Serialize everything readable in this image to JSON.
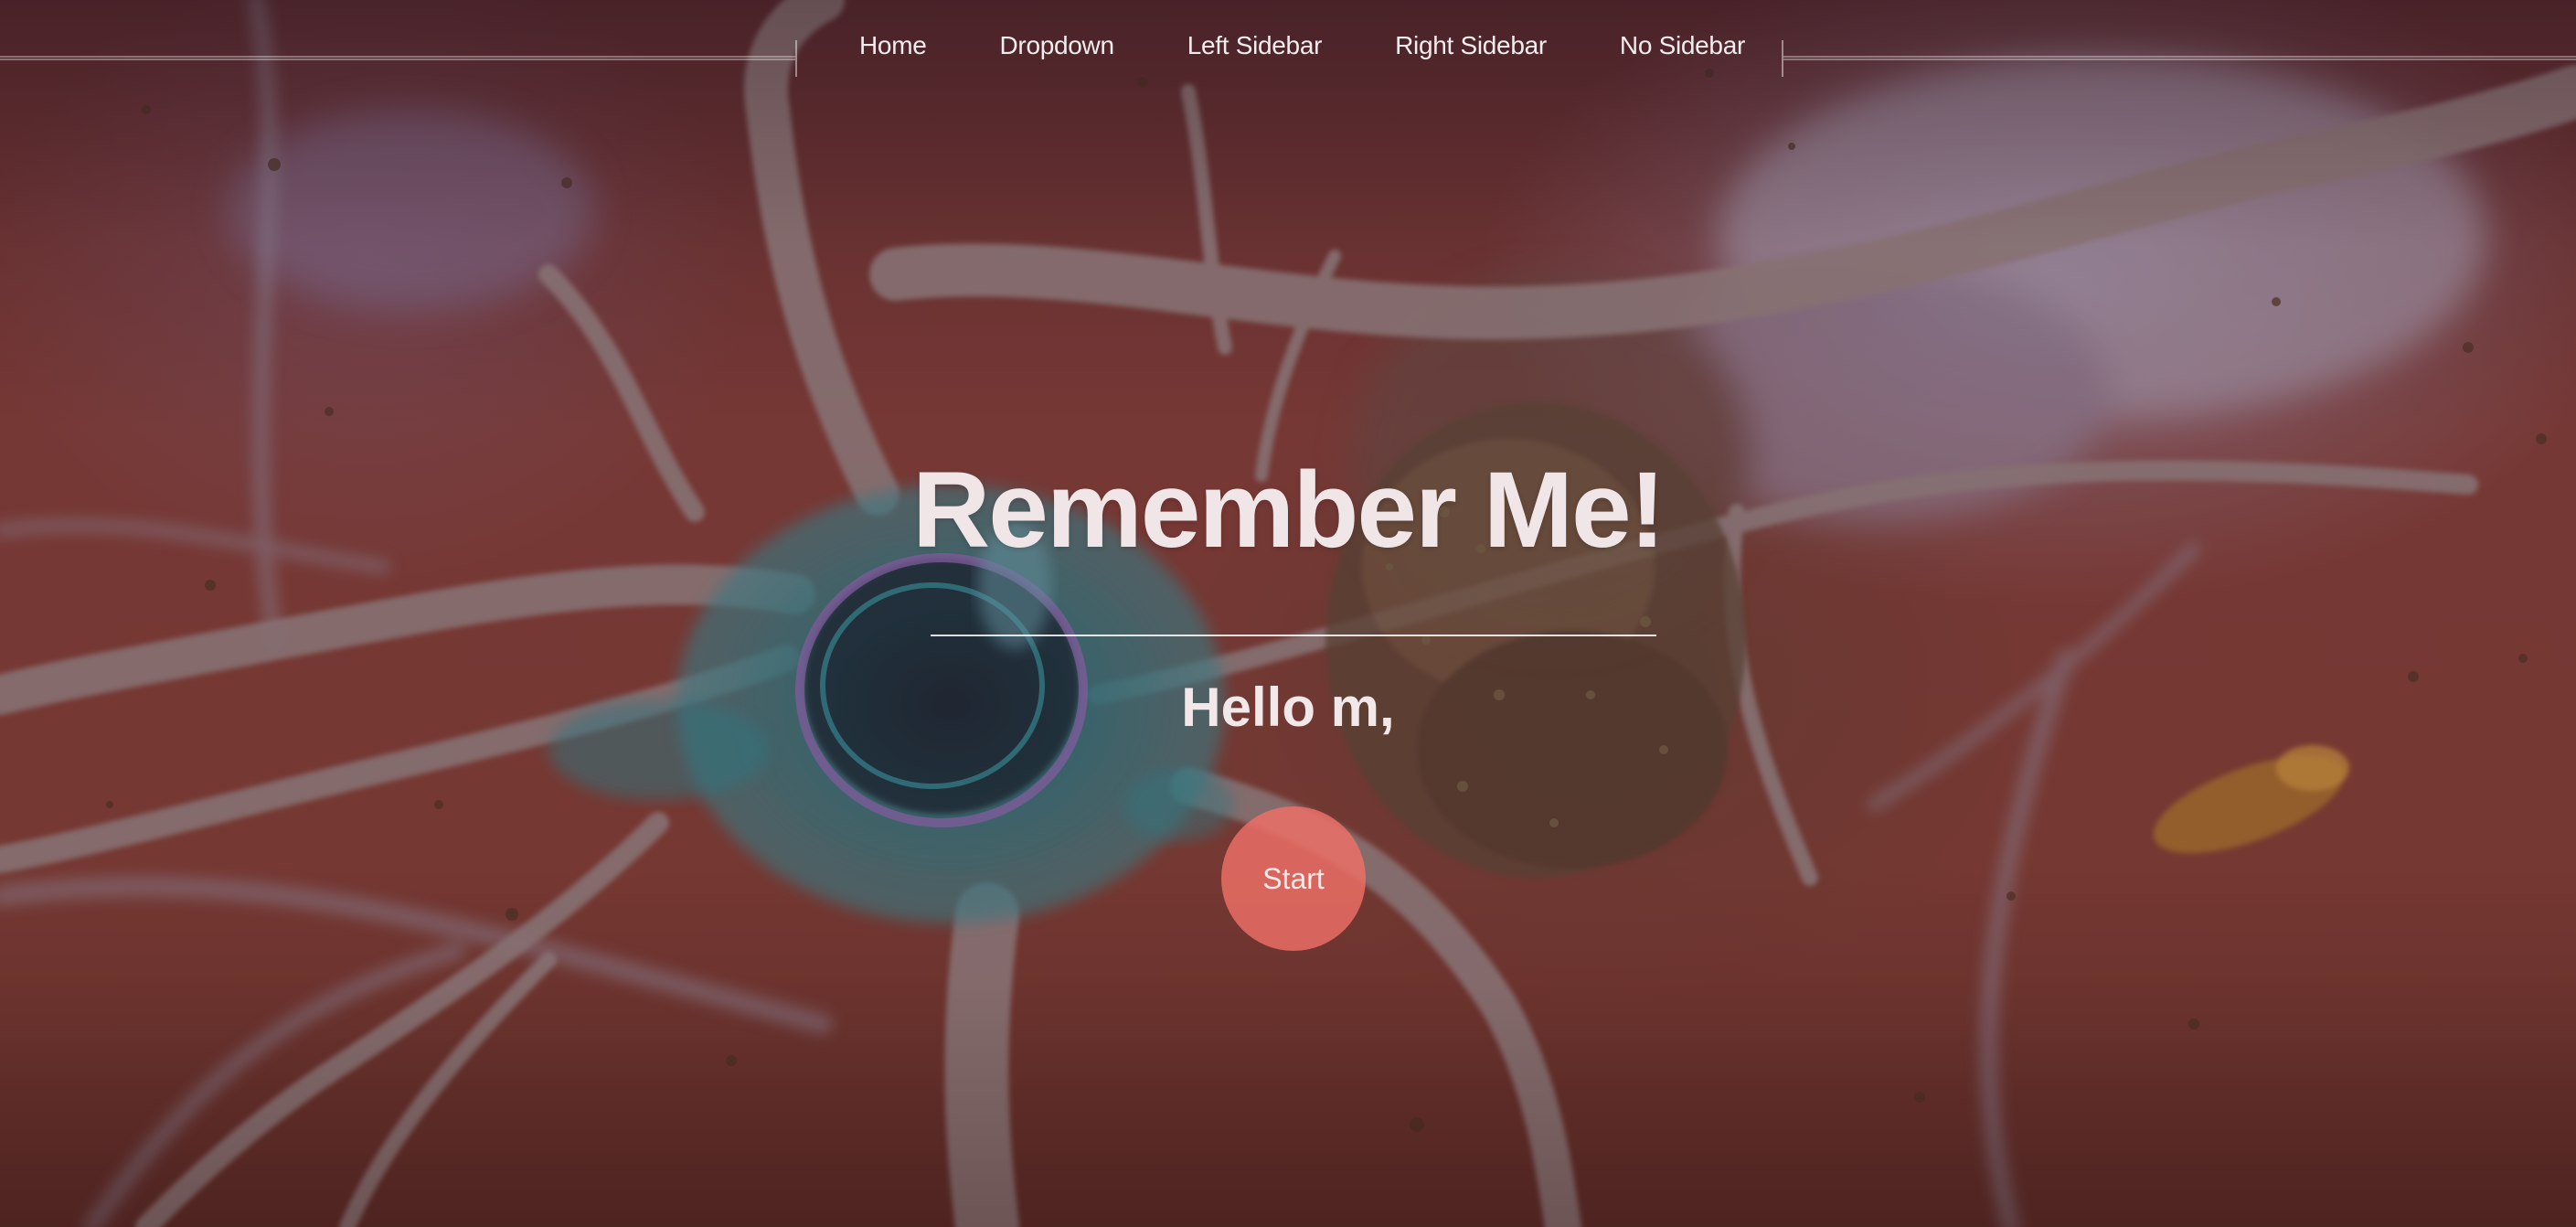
{
  "nav": {
    "items": [
      {
        "label": "Home"
      },
      {
        "label": "Dropdown"
      },
      {
        "label": "Left Sidebar"
      },
      {
        "label": "Right Sidebar"
      },
      {
        "label": "No Sidebar"
      }
    ]
  },
  "hero": {
    "title": "Remember Me!",
    "greeting": "Hello m,",
    "start_label": "Start"
  },
  "colors": {
    "background": "#7a3a36",
    "accent_button": "#ef7068",
    "text": "#f0e6e8"
  },
  "background_image": "neuron-illustration"
}
